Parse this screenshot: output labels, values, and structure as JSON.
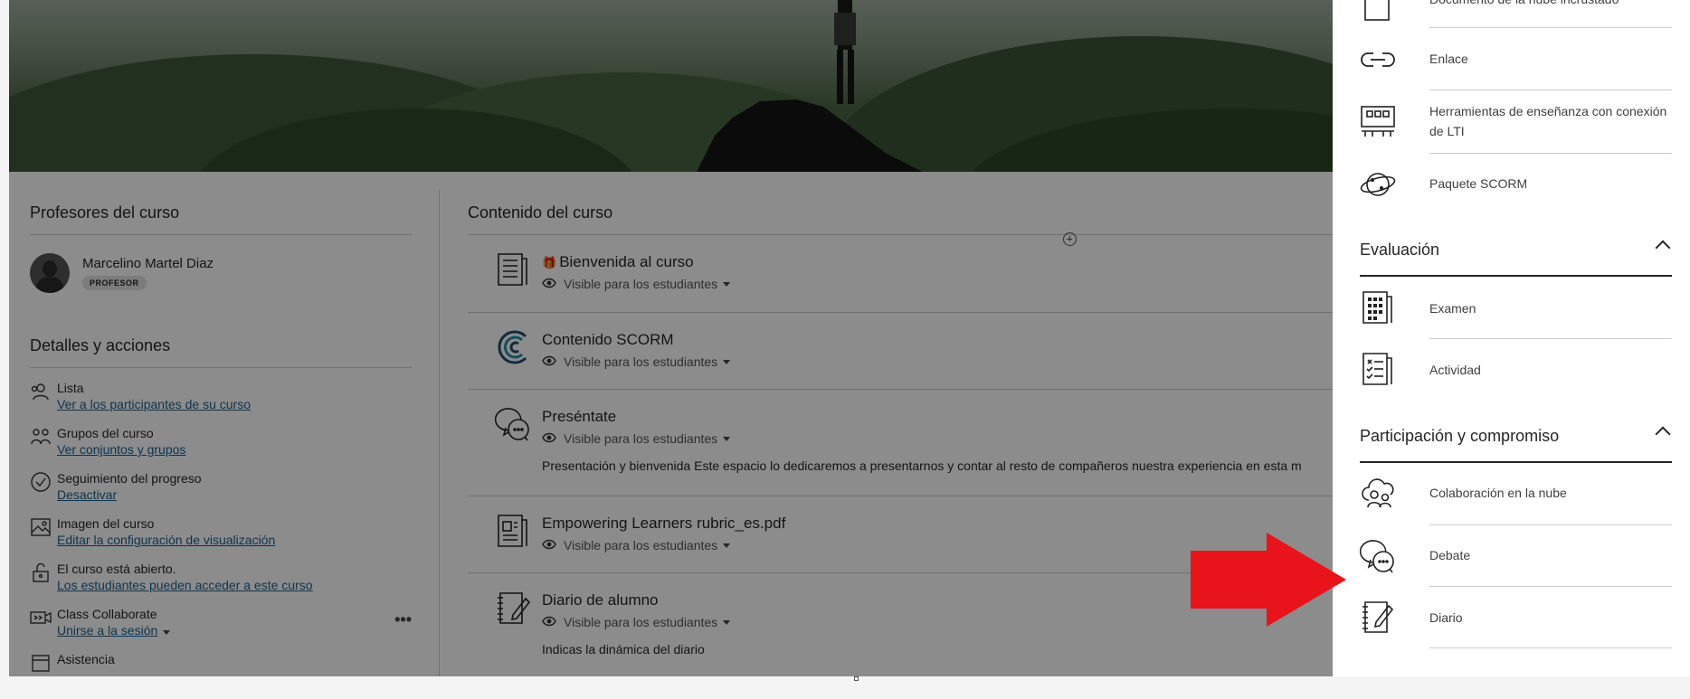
{
  "left_column": {
    "teachers_title": "Profesores del curso",
    "teacher_name": "Marcelino Martel Diaz",
    "teacher_role": "PROFESOR",
    "details_title": "Detalles y acciones",
    "details": [
      {
        "label": "Lista",
        "link": "Ver a los participantes de su curso",
        "icon": "roster-icon"
      },
      {
        "label": "Grupos del curso",
        "link": "Ver conjuntos y grupos",
        "icon": "groups-icon"
      },
      {
        "label": "Seguimiento del progreso",
        "link": "Desactivar",
        "icon": "check-circle-icon"
      },
      {
        "label": "Imagen del curso",
        "link": "Editar la configuración de visualización",
        "icon": "image-icon"
      },
      {
        "label": "El curso está abierto.",
        "link": "Los estudiantes pueden acceder a este curso",
        "icon": "unlock-icon"
      },
      {
        "label": "Class Collaborate",
        "link": "Unirse a la sesión",
        "icon": "video-icon"
      },
      {
        "label": "Asistencia",
        "link": "",
        "icon": "attendance-icon"
      }
    ],
    "more": "•••"
  },
  "content": {
    "title": "Contenido del curso",
    "items": [
      {
        "title": "Bienvenida al curso",
        "visibility": "Visible para los estudiantes",
        "icon": "document-icon",
        "description": ""
      },
      {
        "title": "Contenido SCORM",
        "visibility": "Visible para los estudiantes",
        "icon": "scorm-icon",
        "description": ""
      },
      {
        "title": "Preséntate",
        "visibility": "Visible para los estudiantes",
        "icon": "discussion-icon",
        "description": "Presentación y bienvenida Este espacio lo dedicaremos a presentarnos y contar al resto de compañeros nuestra experiencia en esta m"
      },
      {
        "title": "Empowering Learners rubric_es.pdf",
        "visibility": "Visible para los estudiantes",
        "icon": "file-icon",
        "description": ""
      },
      {
        "title": "Diario de alumno",
        "visibility": "Visible para los estudiantes",
        "icon": "journal-icon",
        "description": "Indicas la dinámica del diario"
      }
    ]
  },
  "panel": {
    "top_items": [
      {
        "label": "Documento de la nube incrustado",
        "icon": "cloud-document-icon"
      },
      {
        "label": "Enlace",
        "icon": "link-icon"
      },
      {
        "label": "Herramientas de enseñanza con conexión de LTI",
        "icon": "lti-icon"
      },
      {
        "label": "Paquete SCORM",
        "icon": "scorm-package-icon"
      }
    ],
    "evaluation_title": "Evaluación",
    "evaluation_items": [
      {
        "label": "Examen",
        "icon": "exam-icon"
      },
      {
        "label": "Actividad",
        "icon": "assignment-icon"
      }
    ],
    "participation_title": "Participación y compromiso",
    "participation_items": [
      {
        "label": "Colaboración en la nube",
        "icon": "cloud-collaboration-icon"
      },
      {
        "label": "Debate",
        "icon": "discussion-icon"
      },
      {
        "label": "Diario",
        "icon": "journal-icon"
      }
    ]
  },
  "colors": {
    "accent_red": "#e8131b",
    "link": "#1b5f8f"
  }
}
